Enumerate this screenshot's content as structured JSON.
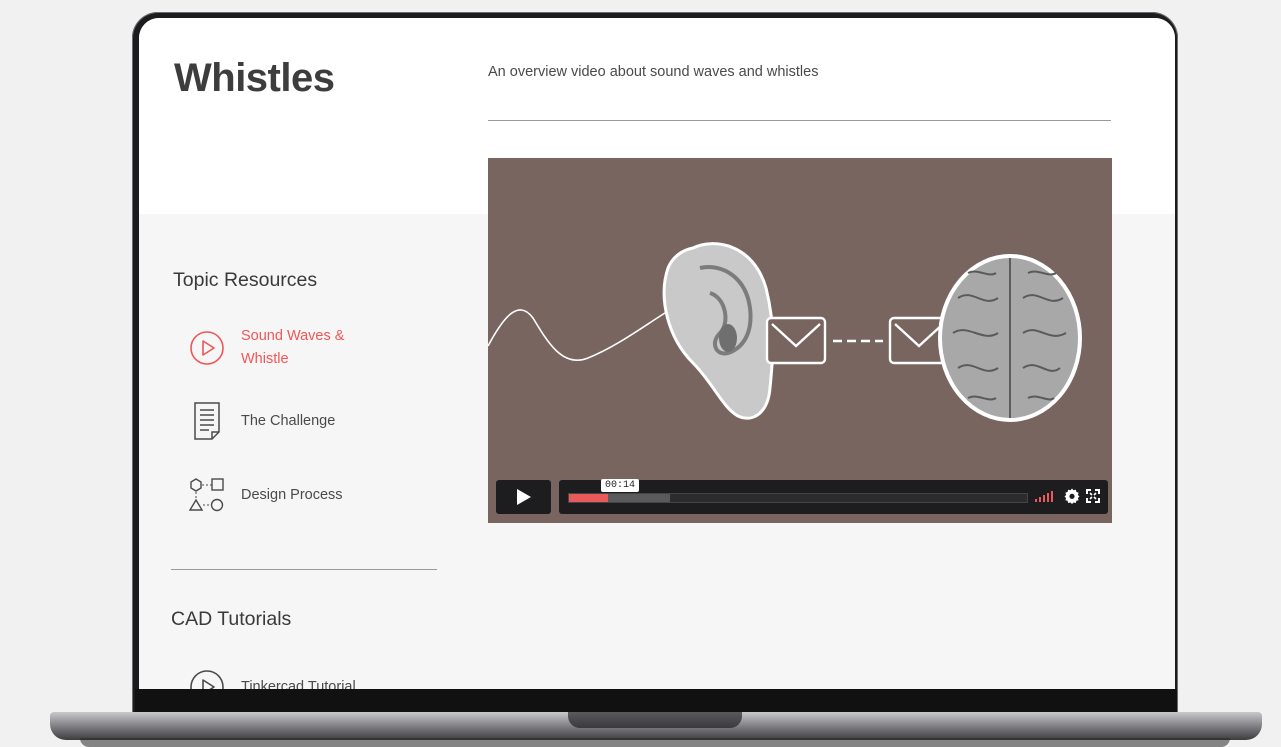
{
  "page": {
    "title": "Whistles",
    "subtitle": "An overview video about sound waves and whistles"
  },
  "sidebar": {
    "topic_heading": "Topic Resources",
    "items": [
      {
        "label": "Sound Waves & Whistle",
        "icon": "play-circle-icon",
        "active": true
      },
      {
        "label": "The Challenge",
        "icon": "document-icon",
        "active": false
      },
      {
        "label": "Design Process",
        "icon": "flowchart-icon",
        "active": false
      }
    ],
    "cad_heading": "CAD Tutorials",
    "cad_items": [
      {
        "label": "Tinkercad Tutorial",
        "icon": "play-circle-icon"
      }
    ]
  },
  "video": {
    "current_time": "00:14",
    "progress": 0.085,
    "buffered": 0.22,
    "controls": [
      "play-icon",
      "volume-icon",
      "gear-icon",
      "fullscreen-icon"
    ]
  },
  "colors": {
    "accent": "#ef5757",
    "video_bg": "#786560",
    "text": "#4a4a4a",
    "header_bg": "#ffffff",
    "body_bg": "#f6f6f6"
  }
}
